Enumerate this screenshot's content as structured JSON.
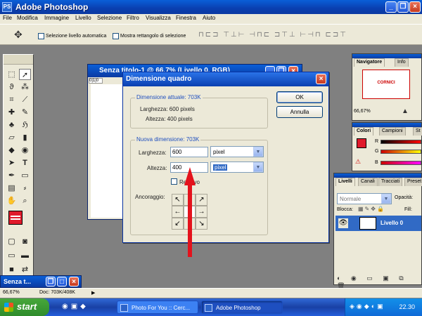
{
  "app": {
    "title": "Adobe Photoshop",
    "icon": "PS"
  },
  "menu": [
    "File",
    "Modifica",
    "Immagine",
    "Livello",
    "Selezione",
    "Filtro",
    "Visualizza",
    "Finestra",
    "Aiuto"
  ],
  "options": {
    "auto_select": "Selezione livello automatica",
    "show_bounds": "Mostra rettangolo di selezione"
  },
  "docwin": {
    "title": "Senza titolo-1 @ 66,7% (Livello 0, RGB)",
    "ruler": "0|1|0"
  },
  "dialog": {
    "title": "Dimensione quadro",
    "current": {
      "legend": "Dimensione attuale:  703K",
      "width": "Larghezza:  600 pixels",
      "height": "Altezza:  400 pixels"
    },
    "new": {
      "legend": "Nuova dimensione:  703K",
      "width_label": "Larghezza:",
      "width_value": "600",
      "width_unit": "pixel",
      "height_label": "Altezza:",
      "height_value": "400",
      "height_unit": "pixel",
      "relative": "Relativo",
      "anchor_label": "Ancoraggio:"
    },
    "ok": "OK",
    "cancel": "Annulla"
  },
  "navigator": {
    "tab1": "Navigatore",
    "tab2": "Info",
    "preview_text": "CORNICI",
    "zoom": "66,67%"
  },
  "colors": {
    "tab1": "Colori",
    "tab2": "Campioni",
    "tab3": "St",
    "r": "R",
    "g": "G",
    "b": "B",
    "fg_color": "#e01a2b"
  },
  "layers": {
    "tab1": "Livelli",
    "tab2": "Canali",
    "tab3": "Tracciati",
    "tab4": "Preset",
    "mode": "Normale",
    "opacity_label": "Opacità:",
    "lock_label": "Blocca:",
    "fill_label": "Fill:",
    "layer_name": "Livello 0"
  },
  "mini_doc": {
    "title": "Senza t..."
  },
  "status": {
    "zoom": "66,67%",
    "doc": "Doc: 703K/408K"
  },
  "taskbar": {
    "start": "start",
    "item1": "Photo For You :: Cerc...",
    "item2": "Adobe Photoshop",
    "time": "22.30"
  }
}
